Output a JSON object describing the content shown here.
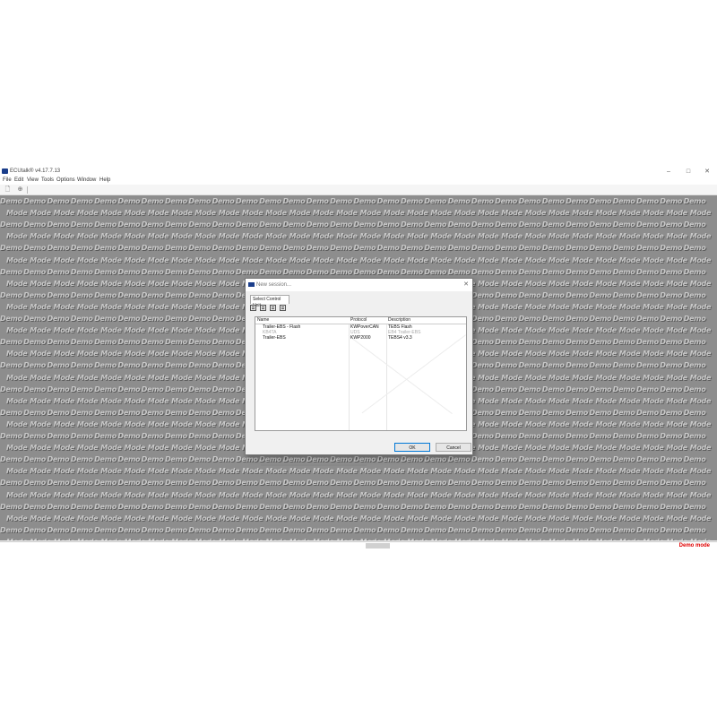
{
  "app": {
    "title": "ECUtalk® v4.17.7.13",
    "window_controls": [
      "–",
      "□",
      "✕"
    ],
    "icon": "app-logo-icon"
  },
  "menu": [
    "File",
    "Edit",
    "View",
    "Tools",
    "Options",
    "Window",
    "Help"
  ],
  "toolbar": {
    "new_icon": "document-new-icon",
    "connect_icon": "connect-icon"
  },
  "watermark": {
    "line1": "Demo",
    "line2": "Mode"
  },
  "status": {
    "demo_label": "Demo mode"
  },
  "dialog": {
    "title": "New session...",
    "close": "✕",
    "tab": "Select Control Unit",
    "icons": [
      "expand-all-icon",
      "collapse-all-icon",
      "filter-icon",
      "list-icon"
    ],
    "columns": [
      "Name",
      "Protocol",
      "Description"
    ],
    "rows": [
      {
        "name": "Trailer-EBS - Flash",
        "protocol": "KWPoverCAN",
        "description": "TEBS Flash",
        "enabled": true
      },
      {
        "name": "KB4TA",
        "protocol": "UDS",
        "description": "EB4 Trailer-EBS",
        "enabled": false
      },
      {
        "name": "Trailer-EBS",
        "protocol": "KWP2000",
        "description": "TEBS4 v3.3",
        "enabled": true
      }
    ],
    "ok_label": "OK",
    "cancel_label": "Cancel"
  }
}
